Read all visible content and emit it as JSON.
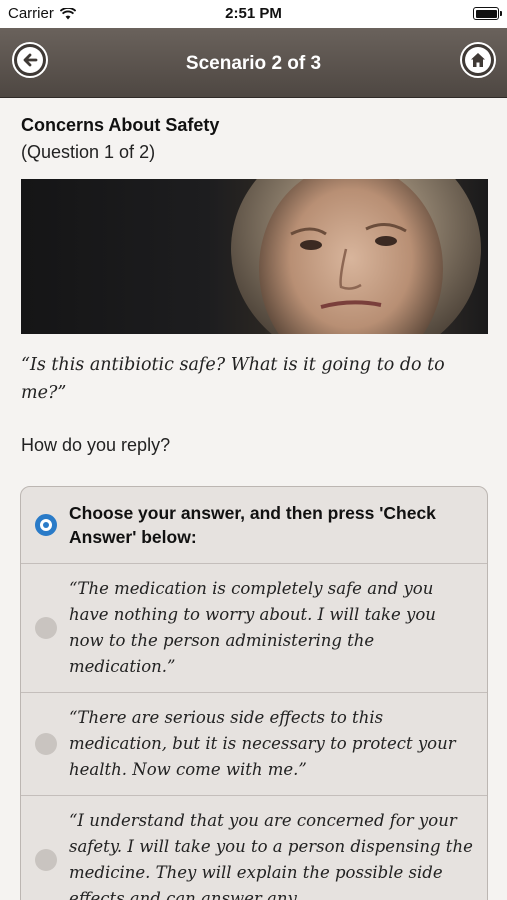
{
  "status_bar": {
    "carrier": "Carrier",
    "time": "2:51 PM"
  },
  "nav": {
    "title": "Scenario 2 of 3",
    "back_icon": "back-arrow-icon",
    "home_icon": "home-icon"
  },
  "page": {
    "title": "Concerns About Safety",
    "subtitle": "(Question 1 of 2)",
    "quote": "“Is this antibiotic safe? What is it going to do to me?”",
    "prompt": "How do you reply?"
  },
  "answers": {
    "header": "Choose your answer, and then press 'Check Answer' below:",
    "options": [
      "“The medication is completely safe and you have nothing to worry about. I will take you now to the person administering the medication.”",
      "“There are serious side effects to this medication, but it is necessary to protect your health. Now come with me.”",
      "“I understand that you are concerned for your safety. I will take you to a person dispensing the medicine. They will explain the possible side effects and can answer any"
    ]
  },
  "colors": {
    "accent": "#2a7bc8",
    "nav_bg": "#5a524c"
  }
}
